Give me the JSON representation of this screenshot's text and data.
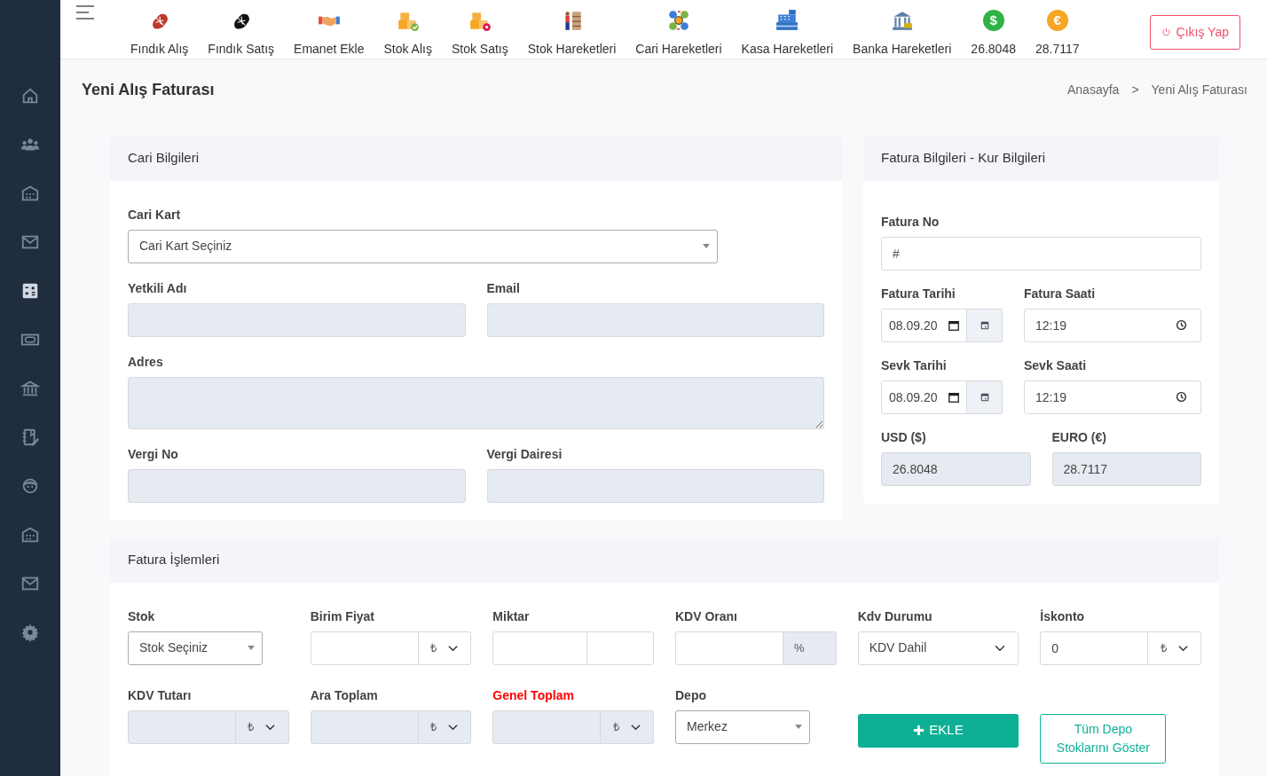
{
  "nav": [
    {
      "label": "Fındık Alış",
      "kind": "picture"
    },
    {
      "label": "Fındık Satış",
      "kind": "picture"
    },
    {
      "label": "Emanet Ekle",
      "kind": "picture"
    },
    {
      "label": "Stok Alış",
      "kind": "picture"
    },
    {
      "label": "Stok Satış",
      "kind": "picture"
    },
    {
      "label": "Stok Hareketleri",
      "kind": "picture"
    },
    {
      "label": "Cari Hareketleri",
      "kind": "picture"
    },
    {
      "label": "Kasa Hareketleri",
      "kind": "picture"
    },
    {
      "label": "Banka Hareketleri",
      "kind": "picture"
    },
    {
      "label": "26.8048",
      "kind": "coin",
      "symbol": "$",
      "color": "#2fb344"
    },
    {
      "label": "28.7117",
      "kind": "coin",
      "symbol": "€",
      "color": "#f5a623"
    }
  ],
  "logout": {
    "label": "Çıkış Yap"
  },
  "sidebar": [
    {
      "selected": false
    },
    {
      "selected": false
    },
    {
      "selected": false
    },
    {
      "selected": false
    },
    {
      "selected": true
    },
    {
      "selected": false
    },
    {
      "selected": false
    },
    {
      "selected": false
    },
    {
      "selected": false
    },
    {
      "selected": false
    },
    {
      "selected": false
    },
    {
      "selected": false
    }
  ],
  "page": {
    "title": "Yeni Alış Faturası",
    "breadcrumb": [
      "Anasayfa",
      "Yeni Alış Faturası"
    ],
    "separator": ">"
  },
  "cari": {
    "title": "Cari Bilgileri",
    "fields": [
      {
        "label": "Cari Kart",
        "kind": "select2",
        "value": "Cari Kart Seçiniz",
        "disabled": false
      },
      {
        "label": "Yetkili Adı",
        "kind": "text",
        "disabled": true
      },
      {
        "label": "Email",
        "kind": "text",
        "disabled": true
      },
      {
        "label": "Adres",
        "kind": "textarea",
        "disabled": true
      },
      {
        "label": "Vergi No",
        "kind": "text",
        "disabled": true
      },
      {
        "label": "Vergi Dairesi",
        "kind": "text",
        "disabled": true
      }
    ]
  },
  "fatura": {
    "title": "Fatura Bilgileri - Kur Bilgileri",
    "fields": [
      {
        "label": "Fatura No",
        "kind": "text",
        "placeholder": "#",
        "disabled": false
      },
      {
        "label": "Fatura Tarihi",
        "kind": "date",
        "value": "08.09.20",
        "disabled": false
      },
      {
        "label": "Fatura Saati",
        "kind": "time",
        "value": "12:19",
        "disabled": false
      },
      {
        "label": "Sevk Tarihi",
        "kind": "date",
        "value": "08.09.20",
        "disabled": false
      },
      {
        "label": "Sevk Saati",
        "kind": "time",
        "value": "12:19",
        "disabled": false
      },
      {
        "label": "USD ($)",
        "kind": "text",
        "value": "26.8048",
        "disabled": true
      },
      {
        "label": "EURO (€)",
        "kind": "text",
        "value": "28.7117",
        "disabled": true
      }
    ]
  },
  "islem": {
    "title": "Fatura İşlemleri",
    "fields": [
      {
        "label": "Stok",
        "kind": "select2",
        "value": "Stok Seçiniz",
        "disabled": false,
        "emphasis": false
      },
      {
        "label": "Birim Fiyat",
        "kind": "currency",
        "addon": "₺",
        "disabled": false,
        "emphasis": false
      },
      {
        "label": "Miktar",
        "kind": "split",
        "disabled": false,
        "emphasis": false
      },
      {
        "label": "KDV Oranı",
        "kind": "percent",
        "addon": "%",
        "disabled": false,
        "emphasis": false
      },
      {
        "label": "Kdv Durumu",
        "kind": "select",
        "value": "KDV Dahil",
        "disabled": false,
        "emphasis": false
      },
      {
        "label": "İskonto",
        "kind": "currency",
        "value": "0",
        "addon": "₺",
        "disabled": false,
        "emphasis": false
      },
      {
        "label": "KDV Tutarı",
        "kind": "currency",
        "addon": "₺",
        "disabled": true,
        "emphasis": false
      },
      {
        "label": "Ara Toplam",
        "kind": "currency",
        "addon": "₺",
        "disabled": true,
        "emphasis": false
      },
      {
        "label": "Genel Toplam",
        "kind": "currency",
        "addon": "₺",
        "disabled": true,
        "emphasis": true
      },
      {
        "label": "Depo",
        "kind": "select2",
        "value": "Merkez",
        "disabled": false,
        "emphasis": false
      }
    ],
    "buttons": [
      {
        "label": "EKLE",
        "kind": "primary"
      },
      {
        "label": "Tüm Depo Stoklarını Göster",
        "kind": "outline"
      }
    ]
  }
}
